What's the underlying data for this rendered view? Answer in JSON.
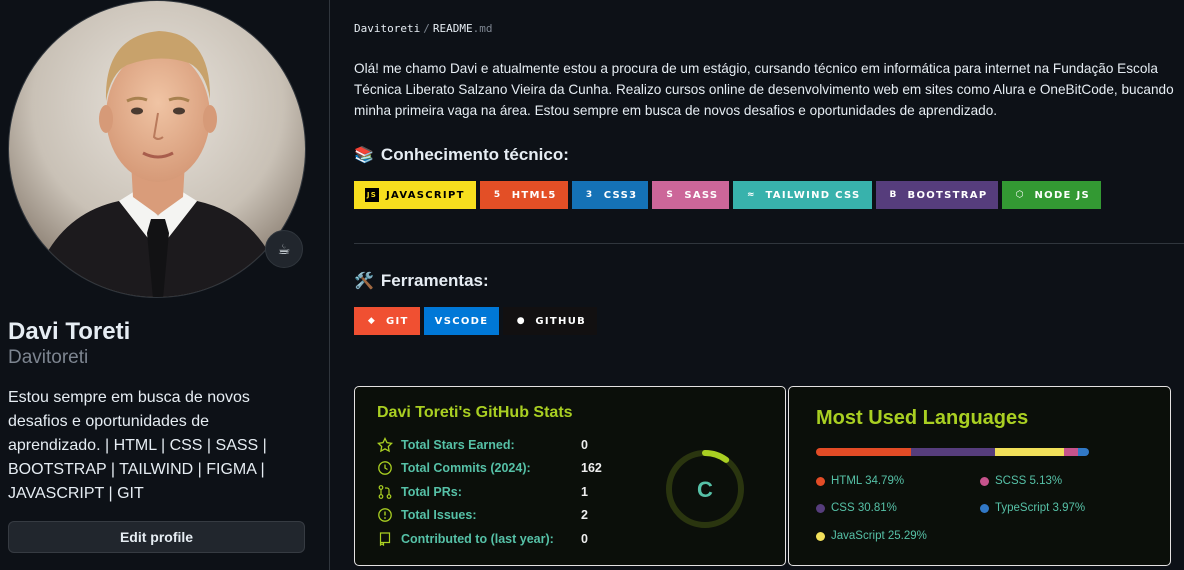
{
  "profile": {
    "name": "Davi Toreti",
    "login": "Davitoreti",
    "bio": "Estou sempre em busca de novos desafios e oportunidades de aprendizado. | HTML | CSS | SASS | BOOTSTRAP | TAILWIND | FIGMA | JAVASCRIPT | GIT",
    "edit_label": "Edit profile",
    "status_emoji": "☕"
  },
  "readme": {
    "breadcrumb_owner": "Davitoreti",
    "breadcrumb_sep": "/",
    "breadcrumb_file": "README",
    "breadcrumb_ext": ".md",
    "intro": "Olá! me chamo Davi e atualmente estou a procura de um estágio, cursando técnico em informática para internet na Fundação Escola Técnica Liberato Salzano Vieira da Cunha. Realizo cursos online de desenvolvimento web em sites como Alura e OneBitCode, bucando minha primeira vaga na área. Estou sempre em busca de novos desafios e oportunidades de aprendizado.",
    "knowledge_heading": "Conhecimento técnico:",
    "knowledge_emoji": "📚",
    "tools_heading": "Ferramentas:",
    "tools_emoji": "🛠️",
    "tech_badges": [
      {
        "label": "JAVASCRIPT",
        "bg": "#f7df1e",
        "fg": "#000000",
        "icon": "javascript-icon",
        "glyph": "JS"
      },
      {
        "label": "HTML5",
        "bg": "#e34f26",
        "fg": "#ffffff",
        "icon": "html5-icon",
        "glyph": "5"
      },
      {
        "label": "CSS3",
        "bg": "#1572b6",
        "fg": "#ffffff",
        "icon": "css3-icon",
        "glyph": "3"
      },
      {
        "label": "SASS",
        "bg": "#cc6699",
        "fg": "#ffffff",
        "icon": "sass-icon",
        "glyph": "S"
      },
      {
        "label": "TAILWIND CSS",
        "bg": "#38b2ac",
        "fg": "#ffffff",
        "icon": "tailwind-icon",
        "glyph": "≈"
      },
      {
        "label": "BOOTSTRAP",
        "bg": "#563d7c",
        "fg": "#ffffff",
        "icon": "bootstrap-icon",
        "glyph": "B"
      },
      {
        "label": "NODE JS",
        "bg": "#339933",
        "fg": "#ffffff",
        "icon": "nodejs-icon",
        "glyph": "⬡"
      }
    ],
    "tool_badges": [
      {
        "label": "GIT",
        "bg": "#f05032",
        "fg": "#ffffff",
        "icon": "git-icon",
        "glyph": "◆"
      },
      {
        "label": "VSCODE",
        "bg": "#0078d7",
        "fg": "#ffffff",
        "icon": "vscode-icon",
        "glyph": ""
      },
      {
        "label": "GITHUB",
        "bg": "#121011",
        "fg": "#ffffff",
        "icon": "github-icon",
        "glyph": "●"
      }
    ]
  },
  "stats": {
    "title": "Davi Toreti's GitHub Stats",
    "rows": [
      {
        "label": "Total Stars Earned:",
        "value": "0",
        "icon": "star-icon"
      },
      {
        "label": "Total Commits (2024):",
        "value": "162",
        "icon": "history-icon"
      },
      {
        "label": "Total PRs:",
        "value": "1",
        "icon": "pull-request-icon"
      },
      {
        "label": "Total Issues:",
        "value": "2",
        "icon": "issue-icon"
      },
      {
        "label": "Contributed to (last year):",
        "value": "0",
        "icon": "repo-icon"
      }
    ],
    "rank": "C",
    "rank_progress": 0.1,
    "colors": {
      "title": "#a9cf22",
      "text": "#56c1a7",
      "value": "#eeeeee",
      "ring": "#a9cf22"
    }
  },
  "languages": {
    "title": "Most Used Languages",
    "items": [
      {
        "name": "HTML",
        "percent": "34.79%",
        "value": 34.79,
        "color": "#e34c26"
      },
      {
        "name": "CSS",
        "percent": "30.81%",
        "value": 30.81,
        "color": "#563d7c"
      },
      {
        "name": "JavaScript",
        "percent": "25.29%",
        "value": 25.29,
        "color": "#f1e05a"
      },
      {
        "name": "SCSS",
        "percent": "5.13%",
        "value": 5.13,
        "color": "#c6538c"
      },
      {
        "name": "TypeScript",
        "percent": "3.97%",
        "value": 3.97,
        "color": "#3178c6"
      }
    ]
  }
}
